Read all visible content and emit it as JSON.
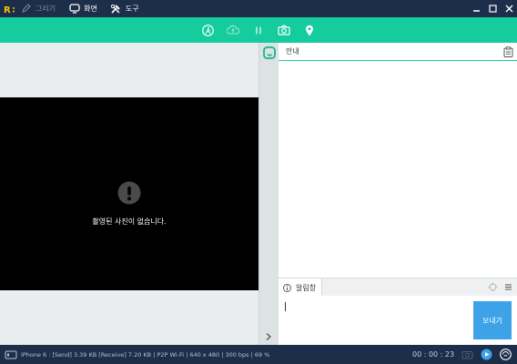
{
  "titlebar": {
    "menu": [
      {
        "label": "그리기",
        "icon": "pen-icon",
        "enabled": false
      },
      {
        "label": "화면",
        "icon": "monitor-icon",
        "enabled": true
      },
      {
        "label": "도구",
        "icon": "tools-icon",
        "enabled": true
      }
    ]
  },
  "toolbar": {
    "buttons": [
      "walk-icon",
      "cloud-icon",
      "pause-icon",
      "camera-icon",
      "location-pin-icon"
    ]
  },
  "photo_view": {
    "empty_message": "촬영된 사진이 없습니다."
  },
  "guide_panel": {
    "title": "안내"
  },
  "alert_panel": {
    "tab_label": "알림창",
    "send_label": "보내기",
    "input_value": ""
  },
  "statusbar": {
    "info": "iPhone 6 : [Send] 3.39 KB   [Receive] 7.20 KB | P2P Wi-Fi | 640 x 480 | 300 bps | 69 %",
    "timer": "00 : 00 : 23"
  },
  "colors": {
    "titlebar": "#1d2e4b",
    "accent": "#14cc9e",
    "send_button": "#3da2e8"
  }
}
